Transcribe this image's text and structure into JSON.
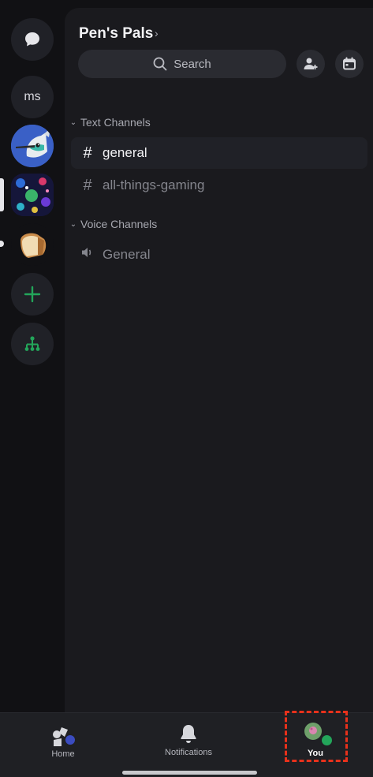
{
  "server": {
    "name": "Pen's Pals",
    "search_label": "Search"
  },
  "rail": {
    "dm_icon": "chat-bubble-icon",
    "initials_server": "ms",
    "add_icon": "plus-icon",
    "discover_icon": "hierarchy-icon"
  },
  "categories": {
    "text": {
      "label": "Text Channels",
      "channels": [
        "general",
        "all-things-gaming"
      ]
    },
    "voice": {
      "label": "Voice Channels",
      "channels": [
        "General"
      ]
    }
  },
  "bottom_nav": {
    "home": "Home",
    "notifications": "Notifications",
    "you": "You"
  },
  "colors": {
    "accent_green": "#23a55a",
    "highlight_red": "#e8311b",
    "badge_blue": "#3b4cc0"
  }
}
